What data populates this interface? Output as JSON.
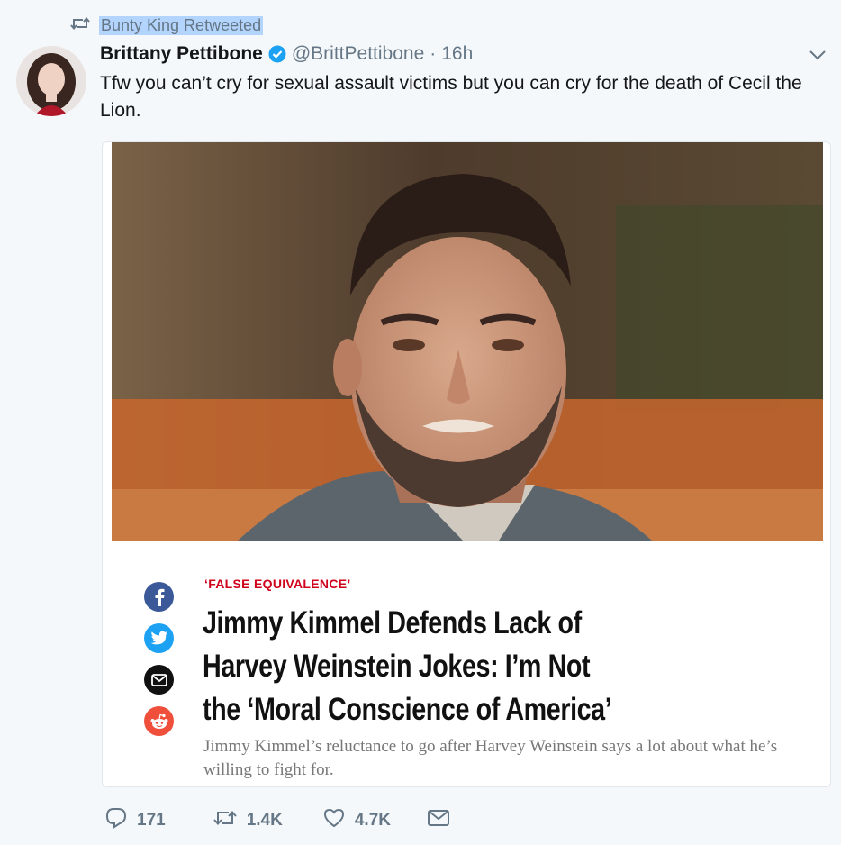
{
  "retweet": {
    "label": "Bunty King Retweeted"
  },
  "tweet": {
    "author_name": "Brittany Pettibone",
    "handle": "@BrittPettibone",
    "separator": "·",
    "time": "16h",
    "text": "Tfw you can’t cry for sexual assault victims but you can cry for the death of Cecil the Lion."
  },
  "card": {
    "kicker": "‘FALSE EQUIVALENCE’",
    "headline": "Jimmy Kimmel Defends Lack of Harvey Weinstein Jokes: I’m Not the ‘Moral Conscience of America’",
    "dek": "Jimmy Kimmel’s reluctance to go after Harvey Weinstein says a lot about what he’s willing to fight for.",
    "share_icons": [
      "facebook-icon",
      "twitter-icon",
      "email-icon",
      "reddit-icon"
    ]
  },
  "actions": {
    "reply_count": "171",
    "retweet_count": "1.4K",
    "like_count": "4.7K"
  },
  "colors": {
    "background": "#f5f8fa",
    "verified": "#1da1f2",
    "kicker": "#d0021b",
    "facebook": "#3b5998",
    "twitter": "#1da1f2",
    "email": "#111111",
    "reddit": "#ef4f3b"
  }
}
